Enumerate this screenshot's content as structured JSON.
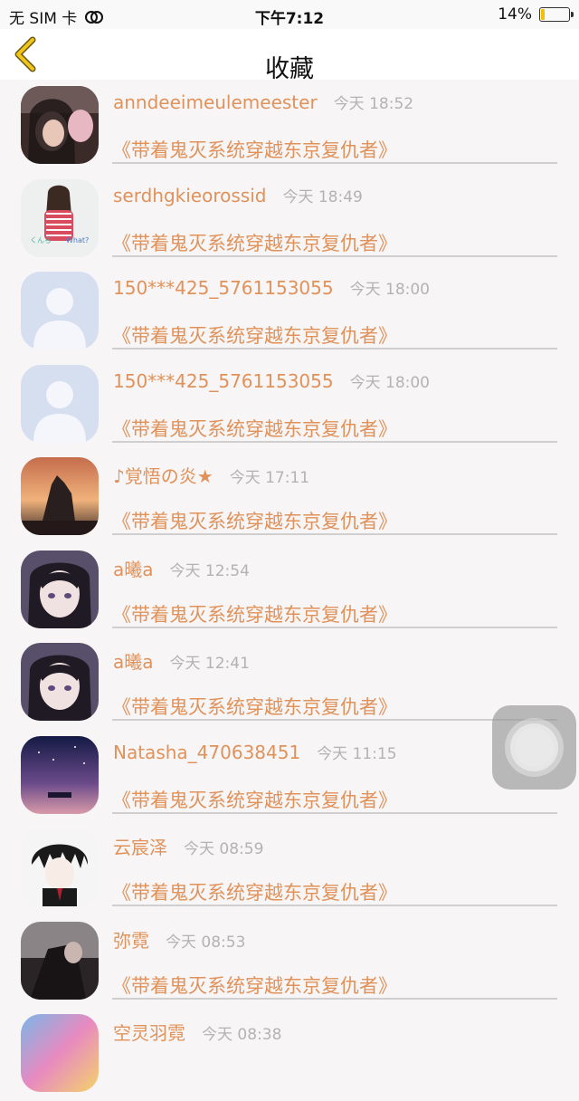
{
  "status": {
    "carrier": "无 SIM 卡",
    "time": "下午7:12",
    "battery_pct": "14%",
    "battery_level": 0.14,
    "icons": [
      "wifi-off-icon",
      "battery-icon"
    ]
  },
  "nav": {
    "title": "收藏",
    "back_icon": "chevron-left-icon",
    "accent": "#f0c419"
  },
  "items": [
    {
      "name": "anndeeimeulemeester",
      "time": "今天 18:52",
      "book": "《带着鬼灭系统穿越东京复仇者》",
      "avatar": "photo-girl"
    },
    {
      "name": "serdhgkieorossid",
      "time": "今天 18:49",
      "book": "《带着鬼灭系统穿越东京复仇者》",
      "avatar": "illustration-girl"
    },
    {
      "name": "150***425_5761153055",
      "time": "今天 18:00",
      "book": "《带着鬼灭系统穿越东京复仇者》",
      "avatar": "default-user"
    },
    {
      "name": "150***425_5761153055",
      "time": "今天 18:00",
      "book": "《带着鬼灭系统穿越东京复仇者》",
      "avatar": "default-user"
    },
    {
      "name": "♪覚悟の炎★",
      "time": "今天 17:11",
      "book": "《带着鬼灭系统穿越东京复仇者》",
      "avatar": "sunset"
    },
    {
      "name": "a曦a",
      "time": "今天 12:54",
      "book": "《带着鬼灭系统穿越东京复仇者》",
      "avatar": "anime-girl"
    },
    {
      "name": "a曦a",
      "time": "今天 12:41",
      "book": "《带着鬼灭系统穿越东京复仇者》",
      "avatar": "anime-girl"
    },
    {
      "name": "Natasha_470638451",
      "time": "今天 11:15",
      "book": "《带着鬼灭系统穿越东京复仇者》",
      "avatar": "night-sky"
    },
    {
      "name": "云宸泽",
      "time": "今天 08:59",
      "book": "《带着鬼灭系统穿越东京复仇者》",
      "avatar": "anime-boy"
    },
    {
      "name": "弥霓",
      "time": "今天 08:53",
      "book": "《带着鬼灭系统穿越东京复仇者》",
      "avatar": "dark-photo"
    },
    {
      "name": "空灵羽霓",
      "time": "今天 08:38",
      "book": "",
      "avatar": "colorful"
    }
  ],
  "colors": {
    "accent_text": "#e0925a",
    "time_text": "#b3b3b3"
  }
}
